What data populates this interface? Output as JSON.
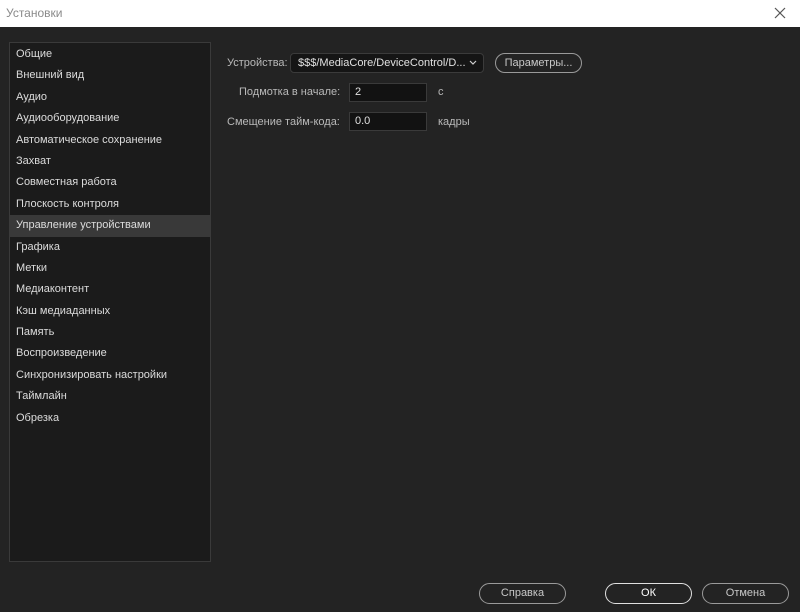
{
  "window": {
    "title": "Установки"
  },
  "sidebar": {
    "items": [
      {
        "label": "Общие"
      },
      {
        "label": "Внешний вид"
      },
      {
        "label": "Аудио"
      },
      {
        "label": "Аудиооборудование"
      },
      {
        "label": "Автоматическое сохранение"
      },
      {
        "label": "Захват"
      },
      {
        "label": "Совместная работа"
      },
      {
        "label": "Плоскость контроля"
      },
      {
        "label": "Управление устройствами"
      },
      {
        "label": "Графика"
      },
      {
        "label": "Метки"
      },
      {
        "label": "Медиаконтент"
      },
      {
        "label": "Кэш медиаданных"
      },
      {
        "label": "Память"
      },
      {
        "label": "Воспроизведение"
      },
      {
        "label": "Синхронизировать настройки"
      },
      {
        "label": "Таймлайн"
      },
      {
        "label": "Обрезка"
      }
    ],
    "selected_index": 8
  },
  "device_control": {
    "devices_label": "Устройства:",
    "devices_value": "$$$/MediaCore/DeviceControl/D...",
    "params_button": "Параметры...",
    "preroll_label": "Подмотка в начале:",
    "preroll_value": "2",
    "preroll_unit": "с",
    "timecode_offset_label": "Смещение тайм-кода:",
    "timecode_offset_value": "0.0",
    "timecode_offset_unit": "кадры"
  },
  "footer": {
    "help_button": "Справка",
    "ok_button": "ОК",
    "cancel_button": "Отмена"
  },
  "colors": {
    "background": "#232323",
    "sidebar_background": "#1b1b1b",
    "selected_item": "#393939",
    "titlebar": "#ffffff"
  }
}
